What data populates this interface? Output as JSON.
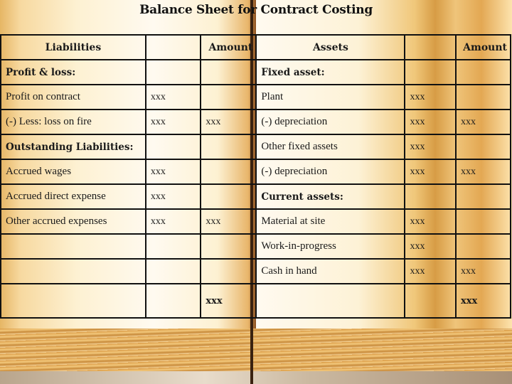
{
  "title": "Balance Sheet for Contract Costing",
  "headers": {
    "liabilities": "Liabilities",
    "liab_amount": "Amount",
    "assets": "Assets",
    "asset_amount": "Amount"
  },
  "rows": [
    {
      "liab": "Profit & loss:",
      "liab_bold": true,
      "l1": "",
      "l2": "",
      "asset": "Fixed asset:",
      "asset_bold": true,
      "a1": "",
      "a2": ""
    },
    {
      "liab": "Profit on contract",
      "l1": "xxx",
      "l2": "",
      "asset": "Plant",
      "a1": "xxx",
      "a2": ""
    },
    {
      "liab": "(-) Less: loss on fire",
      "l1": "xxx",
      "l2": "xxx",
      "asset": "(-) depreciation",
      "a1": "xxx",
      "a2": "xxx"
    },
    {
      "liab": "Outstanding Liabilities:",
      "liab_bold": true,
      "l1": "",
      "l2": "",
      "asset": "Other fixed assets",
      "a1": "xxx",
      "a2": ""
    },
    {
      "liab": "Accrued wages",
      "l1": "xxx",
      "l2": "",
      "asset": "(-) depreciation",
      "a1": "xxx",
      "a2": "xxx"
    },
    {
      "liab": "Accrued direct expense",
      "l1": "xxx",
      "l2": "",
      "asset": "Current assets:",
      "asset_bold": true,
      "a1": "",
      "a2": ""
    },
    {
      "liab": "Other accrued expenses",
      "l1": "xxx",
      "l2": "xxx",
      "asset": "Material at site",
      "a1": "xxx",
      "a2": ""
    },
    {
      "liab": "",
      "l1": "",
      "l2": "",
      "asset": "Work-in-progress",
      "a1": "xxx",
      "a2": ""
    },
    {
      "liab": "",
      "l1": "",
      "l2": "",
      "asset": "Cash in hand",
      "a1": "xxx",
      "a2": "xxx"
    }
  ],
  "totals": {
    "liabilities": "xxx",
    "assets": "xxx"
  }
}
